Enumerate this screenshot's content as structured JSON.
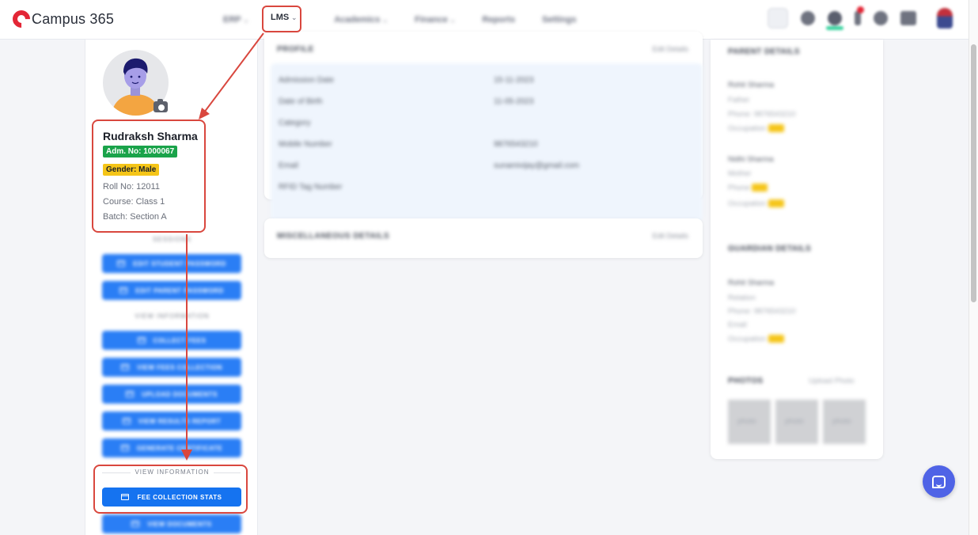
{
  "app": {
    "title": "Campus 365"
  },
  "nav": {
    "items": [
      {
        "label": "ERP",
        "has_dropdown": true,
        "blurred": true
      },
      {
        "label": "LMS",
        "has_dropdown": true,
        "blurred": false
      },
      {
        "label": "Academics",
        "has_dropdown": true,
        "blurred": true
      },
      {
        "label": "Finance",
        "has_dropdown": true,
        "blurred": true
      },
      {
        "label": "Reports",
        "has_dropdown": false,
        "blurred": true
      },
      {
        "label": "Settings",
        "has_dropdown": false,
        "blurred": true
      }
    ]
  },
  "toolbar": {
    "icons": [
      "search-icon",
      "globe-icon",
      "user-status-icon",
      "notification-icon",
      "help-icon",
      "language-icon",
      "user-avatar"
    ]
  },
  "student": {
    "name": "Rudraksh Sharma",
    "adm_no": "Adm. No: 1000067",
    "gender": "Gender: Male",
    "roll_no": "Roll No: 12011",
    "course": "Course: Class 1",
    "batch": "Batch: Section A"
  },
  "left_sections": {
    "section1_title": "SESSIONS",
    "section1_buttons": [
      "EDIT STUDENT PASSWORD",
      "EDIT PARENT PASSWORD"
    ],
    "section2_title": "VIEW INFORMATION",
    "section2_buttons": [
      "COLLECT FEES",
      "VIEW FEES COLLECTION",
      "UPLOAD DOCUMENTS",
      "VIEW RESULTS REPORT",
      "GENERATE CERTIFICATE"
    ],
    "section3_title": "VIEW INFORMATION",
    "section3_buttons": [
      "FEE COLLECTION STATS",
      "VIEW DOCUMENTS"
    ]
  },
  "profile_card": {
    "title": "PROFILE",
    "edit": "Edit Details",
    "rows": [
      {
        "label": "Admission Date",
        "value": "15-11-2023"
      },
      {
        "label": "Date of Birth",
        "value": "11-05-2023"
      },
      {
        "label": "Category",
        "value": ""
      },
      {
        "label": "Mobile Number",
        "value": "9876543210"
      },
      {
        "label": "Email",
        "value": "sunamivijay@gmail.com"
      },
      {
        "label": "RFID Tag Number",
        "value": ""
      }
    ]
  },
  "misc_card": {
    "title": "MISCELLANEOUS DETAILS",
    "edit": "Edit Details"
  },
  "right": {
    "parent_title": "PARENT DETAILS",
    "father_name": "Rohit Sharma",
    "father_rel": "Father",
    "father_phone": "Phone: 9876543210",
    "father_occ": "Occupation",
    "mother_name": "Nidhi Sharma",
    "mother_rel": "Mother",
    "mother_phone": "Phone",
    "mother_occ": "Occupation",
    "guardian_title": "GUARDIAN DETAILS",
    "guardian_name": "Rohit Sharma",
    "guardian_rel": "Relation",
    "guardian_phone": "Phone: 9876543210",
    "guardian_email": "Email",
    "guardian_occ": "Occupation",
    "photos_title": "PHOTOS",
    "photos_upload": "Upload Photo",
    "photo_labels": [
      "photo",
      "photo",
      "photo"
    ]
  },
  "colors": {
    "brand": "#e32636",
    "primary_button": "#1573f0",
    "annotation": "#d9473e",
    "adm_badge": "#1aa34a",
    "gender_badge": "#f5c518",
    "chat": "#4f63e6"
  }
}
